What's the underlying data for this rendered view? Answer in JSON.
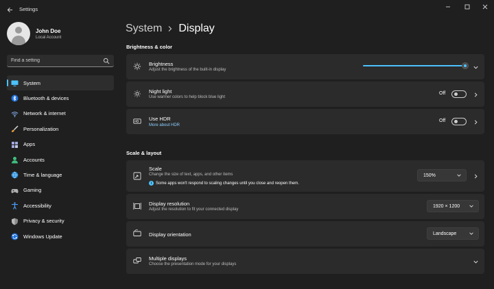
{
  "window": {
    "title": "Settings"
  },
  "profile": {
    "name": "John Doe",
    "account": "Local Account"
  },
  "search": {
    "placeholder": "Find a setting"
  },
  "sidebar": {
    "items": [
      {
        "label": "System",
        "icon": "monitor-icon",
        "color": "#4cc2ff",
        "active": true
      },
      {
        "label": "Bluetooth & devices",
        "icon": "bluetooth-icon",
        "color": "#4c9fff"
      },
      {
        "label": "Network & internet",
        "icon": "wifi-icon",
        "color": "#8ab4f8"
      },
      {
        "label": "Personalization",
        "icon": "brush-icon",
        "color": "#f2a33a"
      },
      {
        "label": "Apps",
        "icon": "apps-icon",
        "color": "#a0a0ff"
      },
      {
        "label": "Accounts",
        "icon": "person-icon",
        "color": "#3fbf7f"
      },
      {
        "label": "Time & language",
        "icon": "globe-icon",
        "color": "#4cc2ff"
      },
      {
        "label": "Gaming",
        "icon": "gamepad-icon",
        "color": "#b0b0b0"
      },
      {
        "label": "Accessibility",
        "icon": "accessibility-icon",
        "color": "#4c9fff"
      },
      {
        "label": "Privacy & security",
        "icon": "shield-icon",
        "color": "#b0b0b0"
      },
      {
        "label": "Windows Update",
        "icon": "update-icon",
        "color": "#4c9fff"
      }
    ]
  },
  "header": {
    "parent": "System",
    "current": "Display"
  },
  "sections": {
    "brightness_color": "Brightness & color",
    "scale_layout": "Scale & layout"
  },
  "settings": {
    "brightness": {
      "title": "Brightness",
      "desc": "Adjust the brightness of the built-in display",
      "value_percent": 100
    },
    "night_light": {
      "title": "Night light",
      "desc": "Use warmer colors to help block blue light",
      "state": "Off"
    },
    "hdr": {
      "title": "Use HDR",
      "link": "More about HDR",
      "state": "Off"
    },
    "scale": {
      "title": "Scale",
      "desc": "Change the size of text, apps, and other items",
      "value": "150%",
      "info": "Some apps won't respond to scaling changes until you close and reopen them."
    },
    "resolution": {
      "title": "Display resolution",
      "desc": "Adjust the resolution to fit your connected display",
      "value": "1920 × 1200"
    },
    "orientation": {
      "title": "Display orientation",
      "value": "Landscape"
    },
    "multiple": {
      "title": "Multiple displays",
      "desc": "Choose the presentation mode for your displays"
    }
  },
  "colors": {
    "accent": "#4cc2ff",
    "background": "#1f1f1f",
    "card": "#2b2b2b"
  }
}
